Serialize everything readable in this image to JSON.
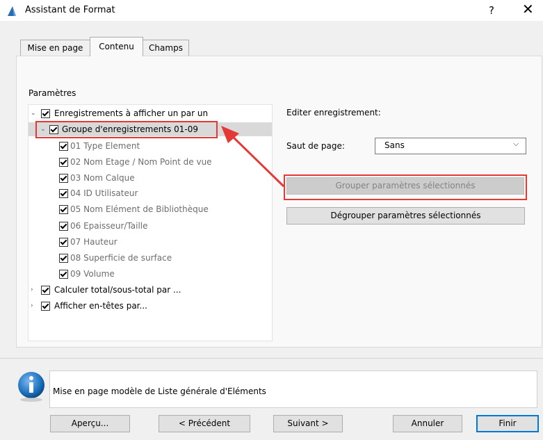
{
  "window": {
    "title": "Assistant de Format",
    "help_glyph": "?",
    "close_glyph": "✕"
  },
  "tabs": [
    {
      "label": "Mise en page",
      "active": false
    },
    {
      "label": "Contenu",
      "active": true
    },
    {
      "label": "Champs",
      "active": false
    }
  ],
  "parametres": {
    "label": "Paramètres",
    "tree": [
      {
        "label": "Enregistrements à afficher un par un",
        "level": 0,
        "expanded": true,
        "checked": true
      },
      {
        "label": "Groupe d'enregistrements 01-09",
        "level": 1,
        "expanded": true,
        "checked": true,
        "selected": true
      },
      {
        "label": "01 Type Element",
        "level": 2,
        "checked": true
      },
      {
        "label": "02 Nom Etage / Nom Point de vue",
        "level": 2,
        "checked": true
      },
      {
        "label": "03 Nom Calque",
        "level": 2,
        "checked": true
      },
      {
        "label": "04 ID Utilisateur",
        "level": 2,
        "checked": true
      },
      {
        "label": "05 Nom Elément de Bibliothèque",
        "level": 2,
        "checked": true
      },
      {
        "label": "06 Epaisseur/Taille",
        "level": 2,
        "checked": true
      },
      {
        "label": "07 Hauteur",
        "level": 2,
        "checked": true
      },
      {
        "label": "08 Superficie de surface",
        "level": 2,
        "checked": true
      },
      {
        "label": "09 Volume",
        "level": 2,
        "checked": true
      },
      {
        "label": "Calculer total/sous-total par ...",
        "level": 0,
        "expanded": false,
        "checked": true
      },
      {
        "label": "Afficher en-têtes par...",
        "level": 0,
        "expanded": false,
        "checked": true
      }
    ]
  },
  "editor": {
    "title": "Editer enregistrement:",
    "saut_label": "Saut de page:",
    "saut_value": "Sans",
    "group_button": "Grouper paramètres sélectionnés",
    "ungroup_button": "Dégrouper paramètres sélectionnés"
  },
  "info": {
    "text": "Mise en page modèle de Liste générale d'Eléments"
  },
  "footer": {
    "apercu": "Aperçu...",
    "precedent": "< Précédent",
    "suivant": "Suivant >",
    "annuler": "Annuler",
    "finir": "Finir"
  },
  "colors": {
    "highlight_red": "#e53935",
    "default_button_border": "#0078d7",
    "info_icon": "#1e73be"
  }
}
